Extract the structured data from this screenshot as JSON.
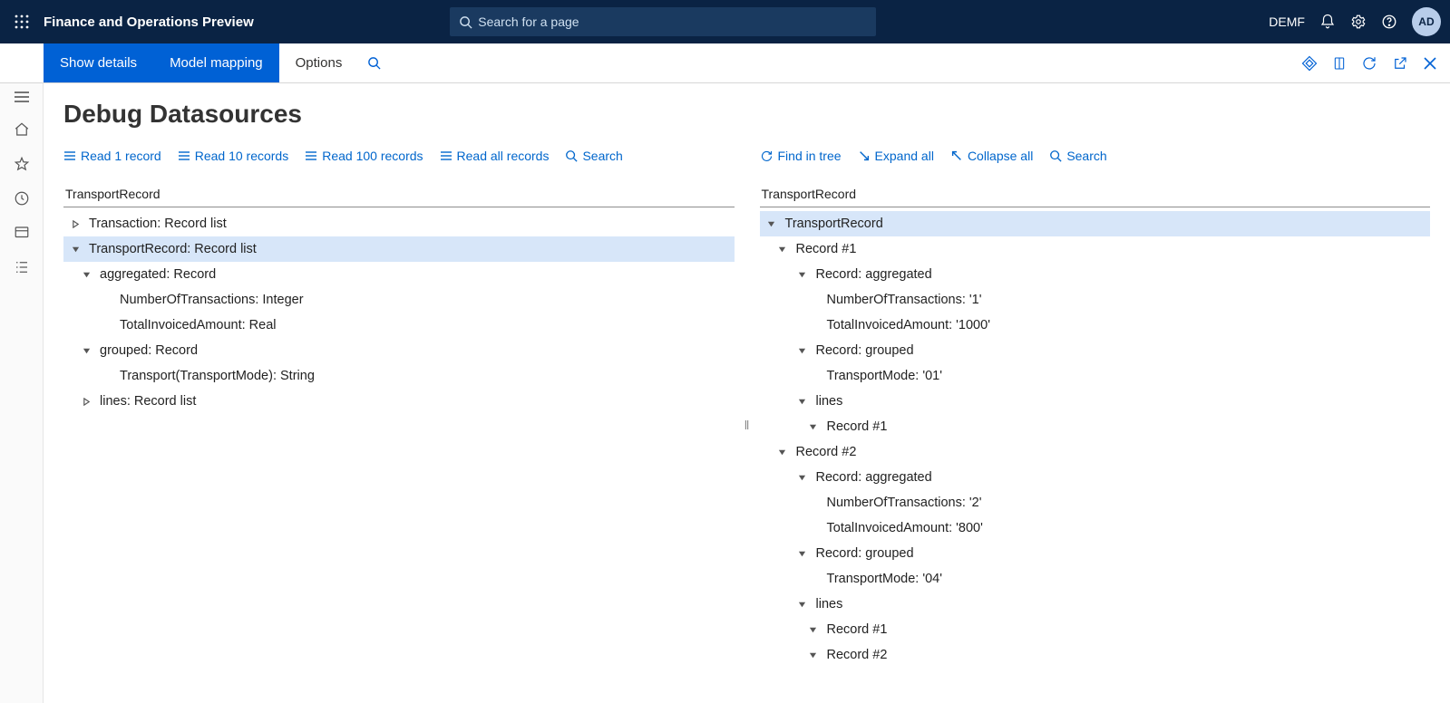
{
  "topbar": {
    "title": "Finance and Operations Preview",
    "search_placeholder": "Search for a page",
    "company": "DEMF",
    "avatar": "AD"
  },
  "actionbar": {
    "show_details": "Show details",
    "model_mapping": "Model mapping",
    "options": "Options"
  },
  "page_title": "Debug Datasources",
  "left_pane": {
    "toolbar": {
      "read1": "Read 1 record",
      "read10": "Read 10 records",
      "read100": "Read 100 records",
      "readall": "Read all records",
      "search": "Search"
    },
    "header": "TransportRecord",
    "tree": [
      {
        "indent": 0,
        "twist": "right",
        "label": "Transaction: Record list",
        "selected": false
      },
      {
        "indent": 0,
        "twist": "down",
        "label": "TransportRecord: Record list",
        "selected": true
      },
      {
        "indent": 1,
        "twist": "down",
        "label": "aggregated: Record",
        "selected": false
      },
      {
        "indent": 2,
        "twist": "none",
        "label": "NumberOfTransactions: Integer",
        "selected": false
      },
      {
        "indent": 2,
        "twist": "none",
        "label": "TotalInvoicedAmount: Real",
        "selected": false
      },
      {
        "indent": 1,
        "twist": "down",
        "label": "grouped: Record",
        "selected": false
      },
      {
        "indent": 2,
        "twist": "none",
        "label": "Transport(TransportMode): String",
        "selected": false
      },
      {
        "indent": 1,
        "twist": "right",
        "label": "lines: Record list",
        "selected": false
      }
    ]
  },
  "right_pane": {
    "toolbar": {
      "find": "Find in tree",
      "expand": "Expand all",
      "collapse": "Collapse all",
      "search": "Search"
    },
    "header": "TransportRecord",
    "tree": [
      {
        "indent": 0,
        "twist": "down",
        "label": "TransportRecord",
        "selected": true
      },
      {
        "indent": 1,
        "twist": "down",
        "label": "Record #1",
        "selected": false
      },
      {
        "indent": 2,
        "twist": "down",
        "label": "Record: aggregated",
        "selected": false
      },
      {
        "indent": 3,
        "twist": "none",
        "label": "NumberOfTransactions: '1'",
        "selected": false
      },
      {
        "indent": 3,
        "twist": "none",
        "label": "TotalInvoicedAmount: '1000'",
        "selected": false
      },
      {
        "indent": 2,
        "twist": "down",
        "label": "Record: grouped",
        "selected": false
      },
      {
        "indent": 3,
        "twist": "none",
        "label": "TransportMode: '01'",
        "selected": false
      },
      {
        "indent": 2,
        "twist": "down",
        "label": "lines",
        "selected": false
      },
      {
        "indent": 3,
        "twist": "down",
        "label": "Record #1",
        "selected": false
      },
      {
        "indent": 1,
        "twist": "down",
        "label": "Record #2",
        "selected": false
      },
      {
        "indent": 2,
        "twist": "down",
        "label": "Record: aggregated",
        "selected": false
      },
      {
        "indent": 3,
        "twist": "none",
        "label": "NumberOfTransactions: '2'",
        "selected": false
      },
      {
        "indent": 3,
        "twist": "none",
        "label": "TotalInvoicedAmount: '800'",
        "selected": false
      },
      {
        "indent": 2,
        "twist": "down",
        "label": "Record: grouped",
        "selected": false
      },
      {
        "indent": 3,
        "twist": "none",
        "label": "TransportMode: '04'",
        "selected": false
      },
      {
        "indent": 2,
        "twist": "down",
        "label": "lines",
        "selected": false
      },
      {
        "indent": 3,
        "twist": "down",
        "label": "Record #1",
        "selected": false
      },
      {
        "indent": 3,
        "twist": "down",
        "label": "Record #2",
        "selected": false
      }
    ]
  }
}
